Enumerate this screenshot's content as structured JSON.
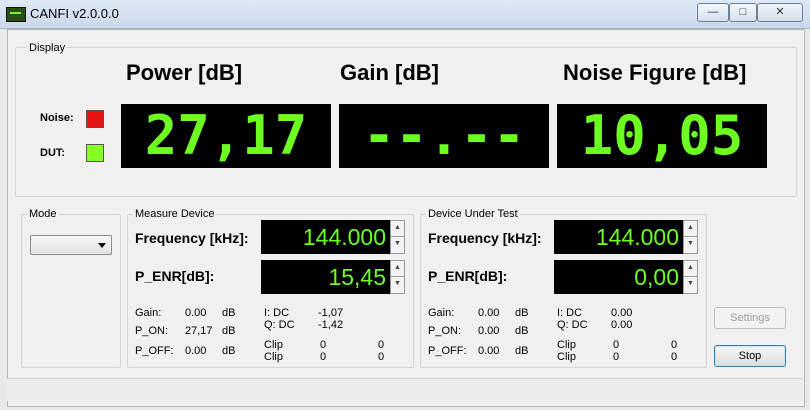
{
  "window": {
    "title": "CANFI v2.0.0.0",
    "min": "—",
    "max": "□",
    "close": "✕"
  },
  "display": {
    "group_label": "Display",
    "power": {
      "title": "Power [dB]",
      "value": "27,17"
    },
    "gain": {
      "title": "Gain [dB]",
      "value": "--.--"
    },
    "noise_figure": {
      "title": "Noise Figure [dB]",
      "value": "10,05"
    },
    "noise_label": "Noise:",
    "dut_label": "DUT:",
    "noise_color": "#ee1111",
    "dut_color": "#88ff22"
  },
  "mode": {
    "group_label": "Mode",
    "selected": ""
  },
  "measure": {
    "group_label": "Measure Device",
    "frequency_label": "Frequency [kHz]:",
    "frequency_value": "144.000",
    "penr_label": "P_ENR[dB]:",
    "penr_value": "15,45",
    "gain_label": "Gain:",
    "gain_value": "0.00",
    "gain_unit": "dB",
    "pon_label": "P_ON:",
    "pon_value": "27,17",
    "pon_unit": "dB",
    "poff_label": "P_OFF:",
    "poff_value": "0.00",
    "poff_unit": "dB",
    "idc_label": "I: DC",
    "idc_value": "-1,07",
    "qdc_label": "Q: DC",
    "qdc_value": "-1,42",
    "clip1_label": "Clip",
    "clip1_a": "0",
    "clip1_b": "0",
    "clip2_label": "Clip",
    "clip2_a": "0",
    "clip2_b": "0"
  },
  "dut": {
    "group_label": "Device Under Test",
    "frequency_label": "Frequency [kHz]:",
    "frequency_value": "144.000",
    "penr_label": "P_ENR[dB]:",
    "penr_value": "0,00",
    "gain_label": "Gain:",
    "gain_value": "0.00",
    "gain_unit": "dB",
    "pon_label": "P_ON:",
    "pon_value": "0.00",
    "pon_unit": "dB",
    "poff_label": "P_OFF:",
    "poff_value": "0.00",
    "poff_unit": "dB",
    "idc_label": "I: DC",
    "idc_value": "0.00",
    "qdc_label": "Q: DC",
    "qdc_value": "0.00",
    "clip1_label": "Clip",
    "clip1_a": "0",
    "clip1_b": "0",
    "clip2_label": "Clip",
    "clip2_a": "0",
    "clip2_b": "0"
  },
  "buttons": {
    "settings": "Settings",
    "stop": "Stop"
  }
}
